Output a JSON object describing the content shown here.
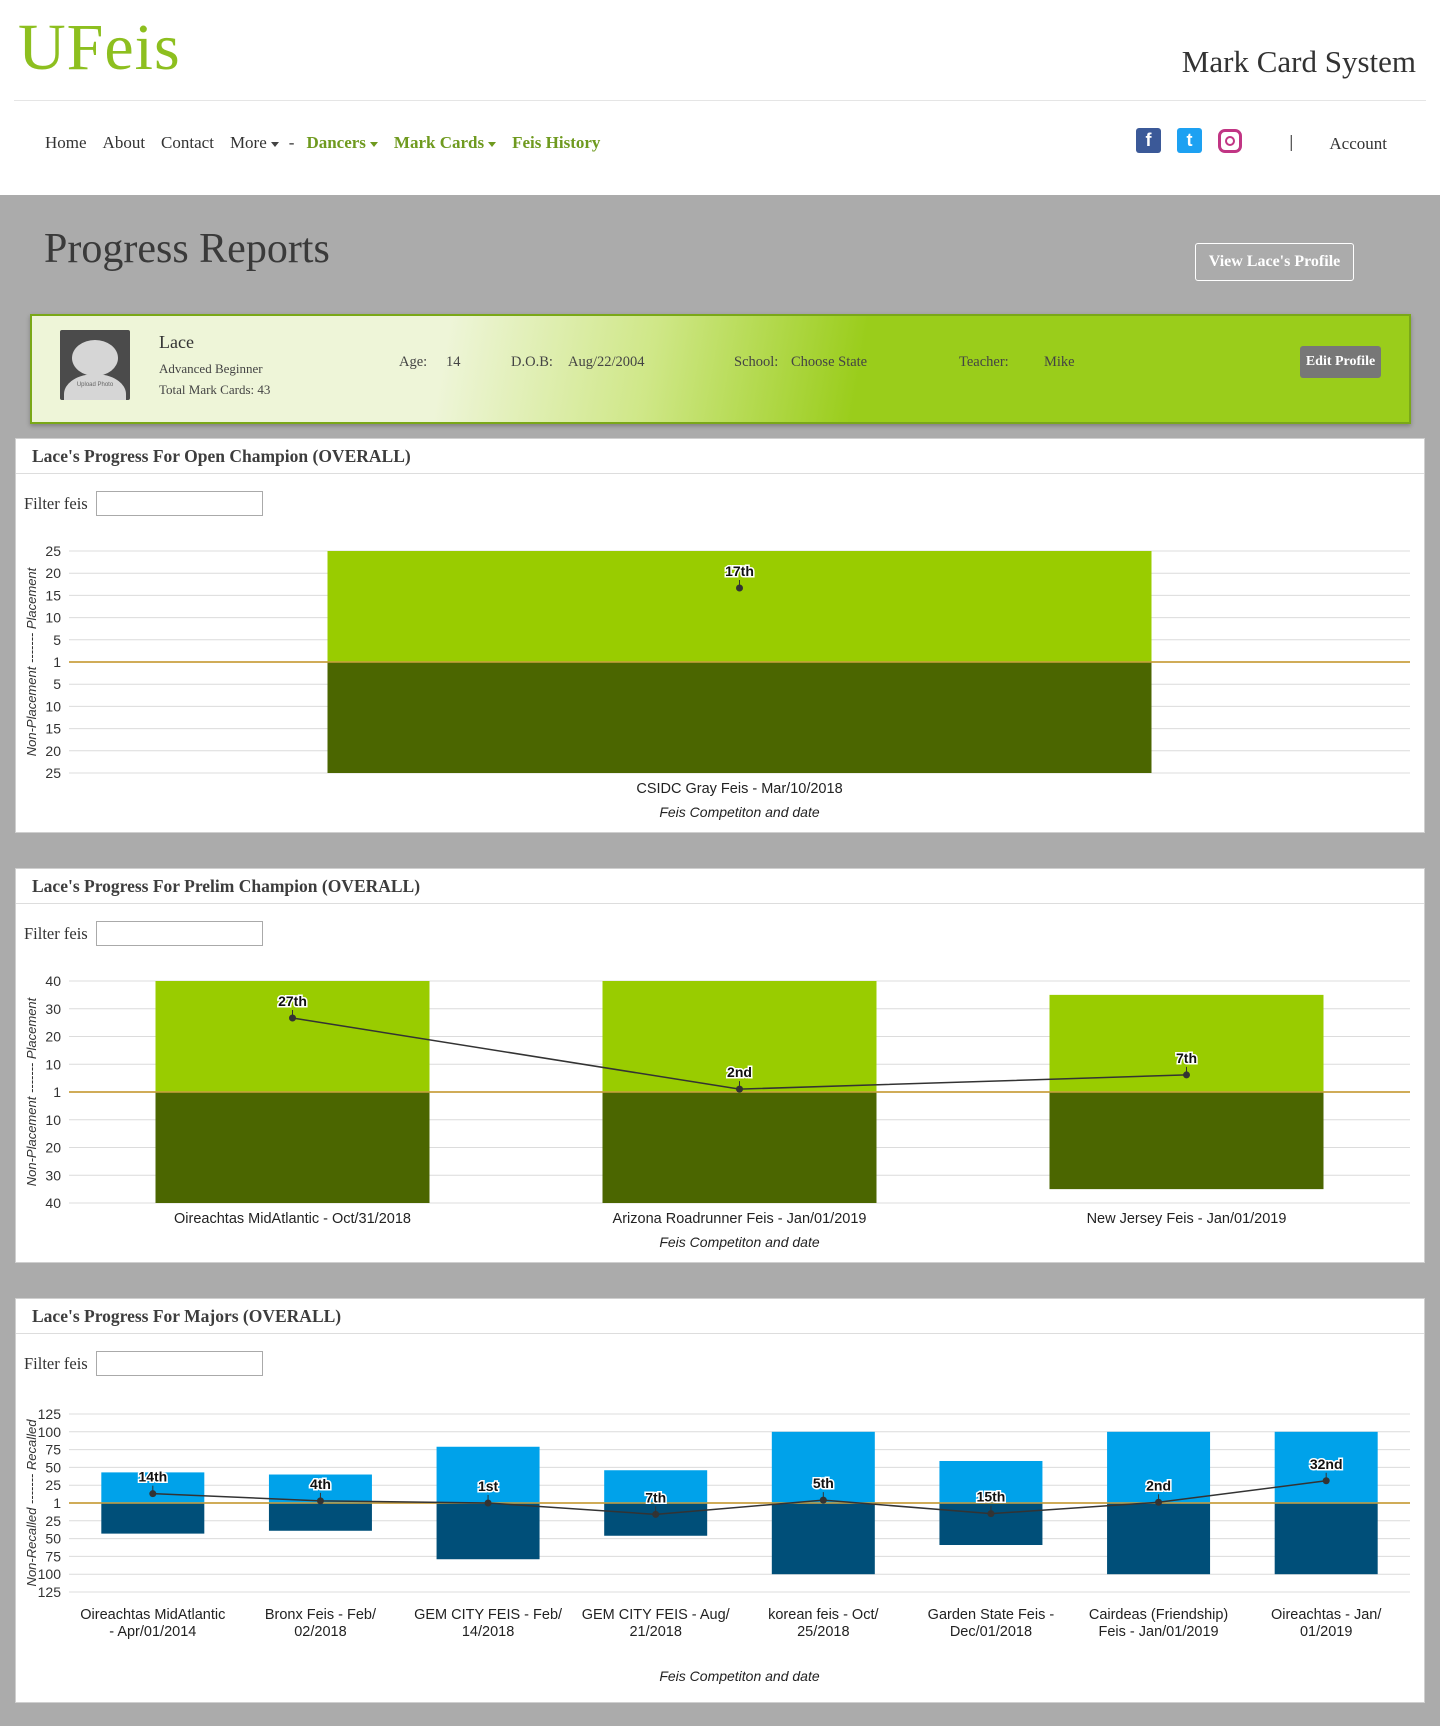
{
  "header": {
    "logo": "UFeis",
    "site_title": "Mark Card System",
    "nav": {
      "home": "Home",
      "about": "About",
      "contact": "Contact",
      "more": "More",
      "separator": "-",
      "dancers": "Dancers",
      "mark_cards": "Mark Cards",
      "feis_history": "Feis History"
    },
    "social": {
      "facebook": "f",
      "twitter": "t",
      "instagram": "instagram-icon"
    },
    "account_separator": "|",
    "account": "Account"
  },
  "page": {
    "title": "Progress Reports",
    "view_profile_button": "View Lace's Profile"
  },
  "profile": {
    "avatar_caption": "Upload Photo",
    "name": "Lace",
    "level": "Advanced Beginner",
    "total_mark_cards": "Total Mark Cards: 43",
    "age_label": "Age:",
    "age": "14",
    "dob_label": "D.O.B:",
    "dob": "Aug/22/2004",
    "school_label": "School:",
    "school": "Choose State",
    "teacher_label": "Teacher:",
    "teacher": "Mike",
    "edit_button": "Edit Profile"
  },
  "colors": {
    "green_top": "#99cc00",
    "green_bottom": "#4b6600",
    "blue_top": "#00a2ea",
    "blue_bottom": "#004f79",
    "baseline": "#c9a041"
  },
  "chart_data": [
    {
      "type": "bar",
      "panel_title": "Lace's Progress For Open Champion (OVERALL)",
      "filter_label": "Filter feis",
      "ylabel": "Non-Placement ------- Placement",
      "xlabel": "Feis Competiton and date",
      "y_ticks_top": [
        "25",
        "20",
        "15",
        "10",
        "5",
        "1"
      ],
      "y_ticks_bottom": [
        "5",
        "10",
        "15",
        "20",
        "25"
      ],
      "scale": 25,
      "categories": [
        "CSIDC Gray Feis - Mar/10/2018"
      ],
      "category_lines": [
        [
          "CSIDC Gray Feis - Mar/10/2018"
        ]
      ],
      "top_values": [
        25
      ],
      "bottom_values": [
        25
      ],
      "placements": [
        17
      ],
      "labels": [
        "17th"
      ],
      "colors": [
        "#99cc00",
        "#4b6600"
      ]
    },
    {
      "type": "bar",
      "panel_title": "Lace's Progress For Prelim Champion (OVERALL)",
      "filter_label": "Filter feis",
      "ylabel": "Non-Placement ------- Placement",
      "xlabel": "Feis Competiton and date",
      "y_ticks_top": [
        "40",
        "30",
        "20",
        "10",
        "1"
      ],
      "y_ticks_bottom": [
        "10",
        "20",
        "30",
        "40"
      ],
      "scale": 40,
      "categories": [
        "Oireachtas MidAtlantic - Oct/31/2018",
        "Arizona Roadrunner Feis - Jan/01/2019",
        "New Jersey Feis - Jan/01/2019"
      ],
      "category_lines": [
        [
          "Oireachtas MidAtlantic - Oct/31/2018"
        ],
        [
          "Arizona Roadrunner Feis - Jan/01/2019"
        ],
        [
          "New Jersey Feis - Jan/01/2019"
        ]
      ],
      "top_values": [
        40,
        40,
        35
      ],
      "bottom_values": [
        40,
        40,
        35
      ],
      "placements": [
        27,
        2,
        7
      ],
      "labels": [
        "27th",
        "2nd",
        "7th"
      ],
      "colors": [
        "#99cc00",
        "#4b6600"
      ]
    },
    {
      "type": "bar",
      "panel_title": "Lace's Progress For Majors (OVERALL)",
      "filter_label": "Filter feis",
      "ylabel": "Non-Recalled ------- Recalled",
      "xlabel": "Feis Competiton and date",
      "y_ticks_top": [
        "125",
        "100",
        "75",
        "50",
        "25",
        "1"
      ],
      "y_ticks_bottom": [
        "25",
        "50",
        "75",
        "100",
        "125"
      ],
      "scale": 125,
      "categories": [
        "Oireachtas MidAtlantic - Apr/01/2014",
        "Bronx Feis - Feb/02/2018",
        "GEM CITY FEIS - Feb/14/2018",
        "GEM CITY FEIS - Aug/21/2018",
        "korean feis - Oct/25/2018",
        "Garden State Feis - Dec/01/2018",
        "Cairdeas (Friendship) Feis - Jan/01/2019",
        "Oireachtas - Jan/01/2019"
      ],
      "category_lines": [
        [
          "Oireachtas MidAtlantic",
          "- Apr/01/2014"
        ],
        [
          "Bronx Feis - Feb/",
          "02/2018"
        ],
        [
          "GEM CITY FEIS - Feb/",
          "14/2018"
        ],
        [
          "GEM CITY FEIS - Aug/",
          "21/2018"
        ],
        [
          "korean feis - Oct/",
          "25/2018"
        ],
        [
          "Garden State Feis -",
          "Dec/01/2018"
        ],
        [
          "Cairdeas (Friendship)",
          "Feis - Jan/01/2019"
        ],
        [
          "Oireachtas - Jan/",
          "01/2019"
        ]
      ],
      "top_values": [
        43,
        40,
        79,
        46,
        100,
        59,
        100,
        100
      ],
      "bottom_values": [
        43,
        39,
        79,
        46,
        100,
        59,
        100,
        100
      ],
      "points": [
        14,
        4,
        1,
        -16,
        5,
        -15,
        2,
        32
      ],
      "labels": [
        "14th",
        "4th",
        "1st",
        "7th",
        "5th",
        "15th",
        "2nd",
        "32nd"
      ],
      "colors": [
        "#00a2ea",
        "#004f79"
      ]
    }
  ]
}
